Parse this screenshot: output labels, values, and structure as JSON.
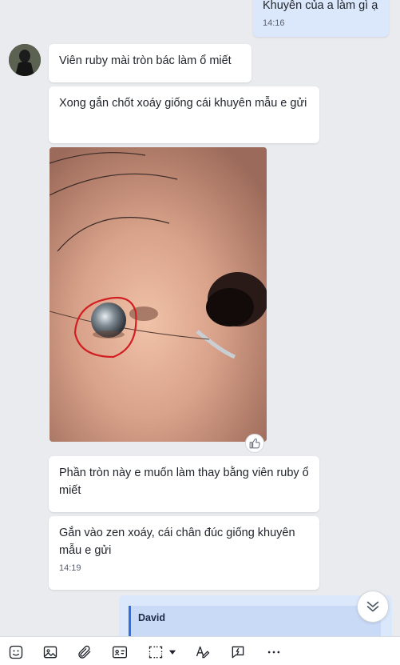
{
  "messages": {
    "top_partial": {
      "text": "Khuyên của a làm gì ạ",
      "time": "14:16"
    },
    "m1": {
      "text": "Viên ruby mài tròn bác làm ổ miết"
    },
    "m2": {
      "text": "Xong gắn chốt xoáy giống cái khuyên mẫu e gửi"
    },
    "m3": {
      "text": "Phần tròn này e muốn làm thay bằng viên ruby ổ miết"
    },
    "m4": {
      "text": "Gắn vào zen xoáy, cái chân đúc giống khuyên mẫu e gửi",
      "time": "14:19"
    }
  },
  "quote": {
    "author": "David"
  },
  "toolbar": {
    "icons": [
      "sticker-icon",
      "image-icon",
      "attachment-icon",
      "contact-card-icon",
      "screenshot-icon",
      "dropdown-arrow-icon",
      "text-format-icon",
      "quick-reply-icon",
      "more-icon"
    ]
  },
  "colors": {
    "my_bubble": "#dbe8fb",
    "other_bubble": "#ffffff",
    "background": "#e9ebef",
    "accent": "#2f6fe0"
  }
}
